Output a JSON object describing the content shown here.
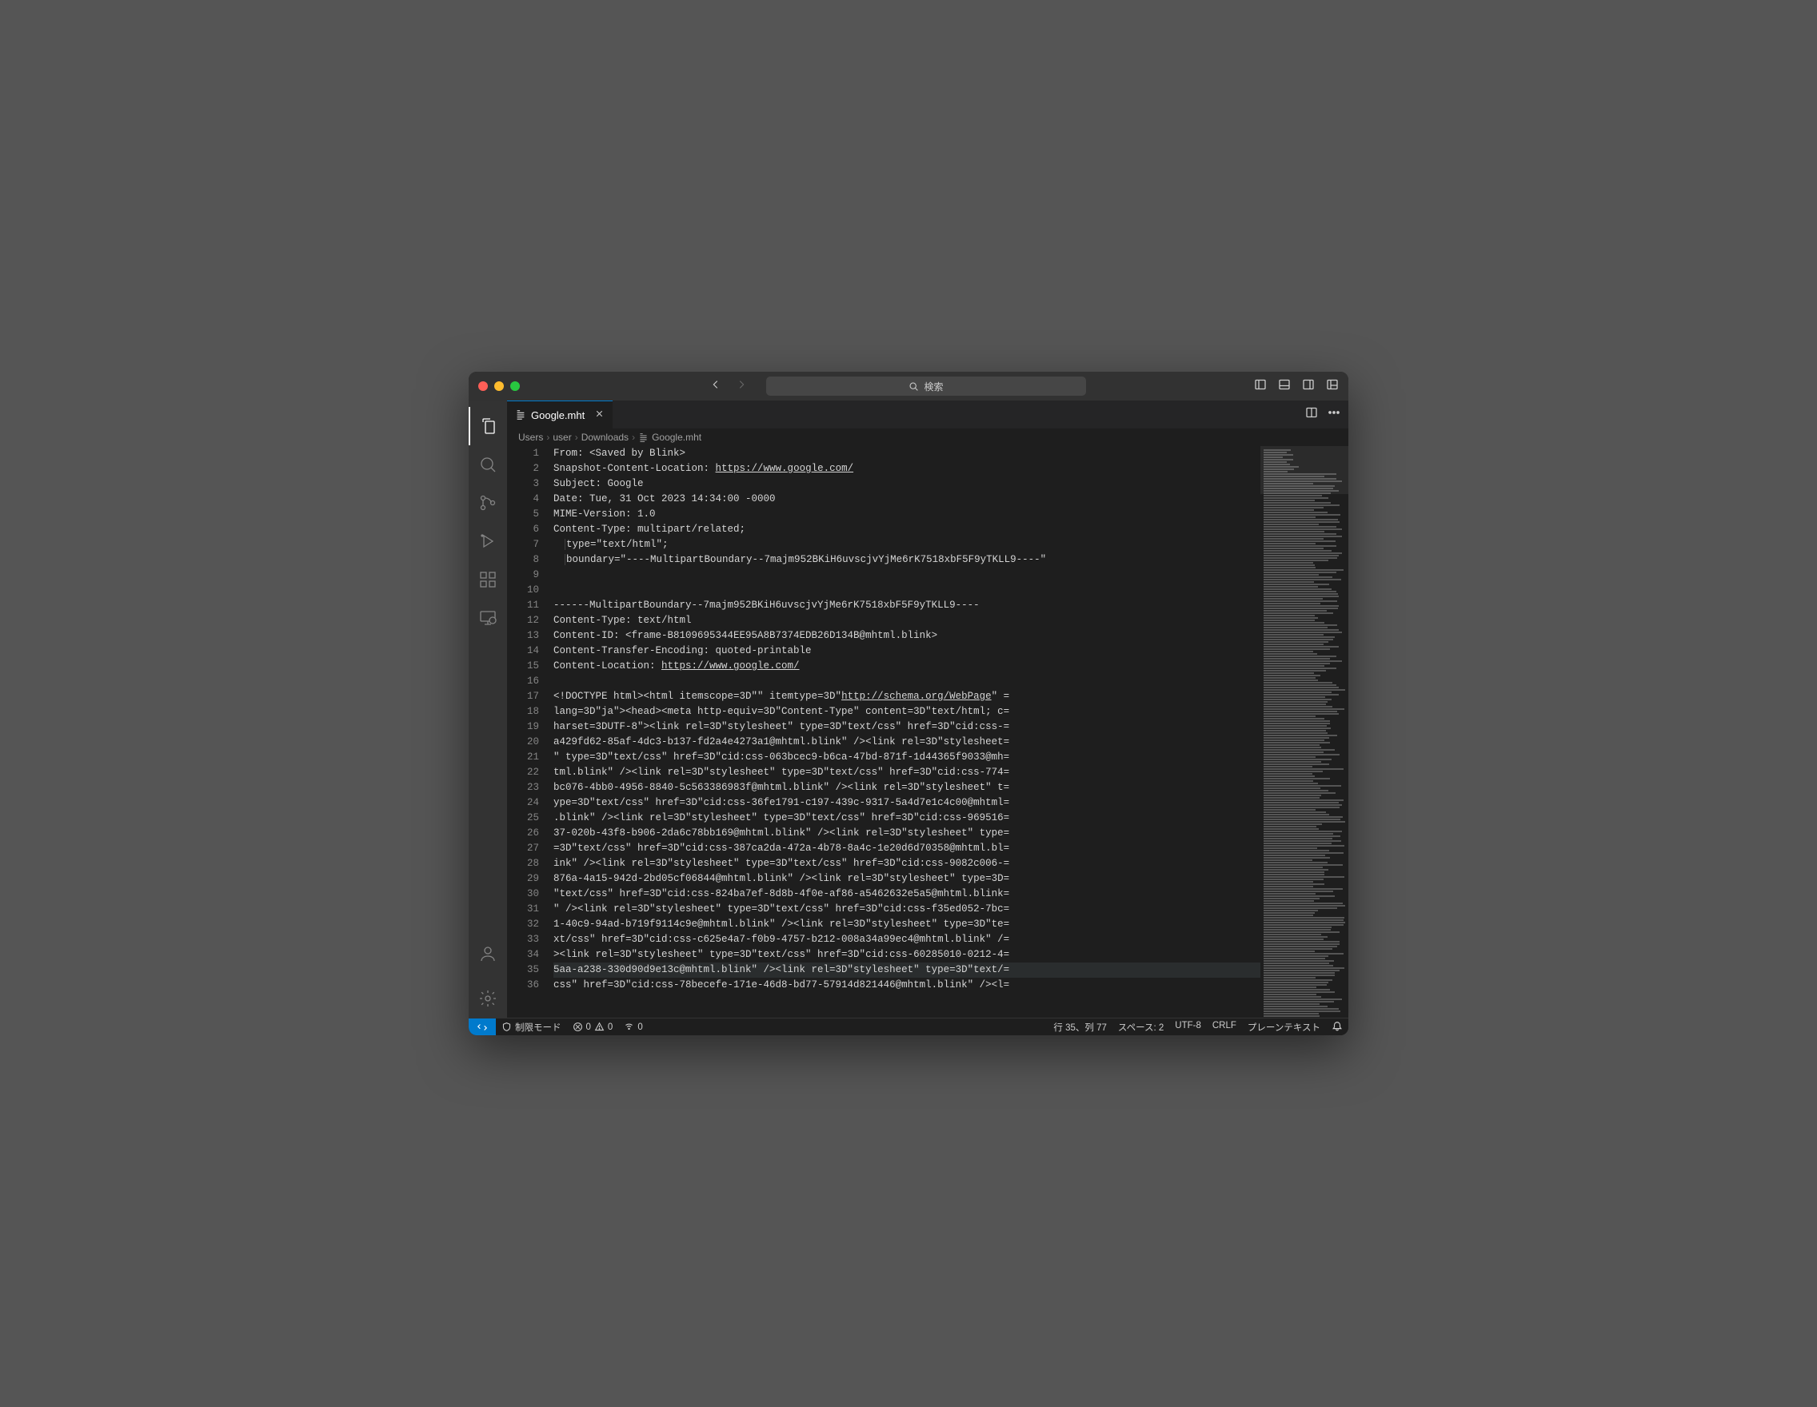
{
  "titlebar": {
    "search_placeholder": "検索"
  },
  "tab": {
    "filename": "Google.mht"
  },
  "breadcrumb": {
    "parts": [
      "Users",
      "user",
      "Downloads",
      "Google.mht"
    ]
  },
  "editor": {
    "lines": [
      {
        "n": 1,
        "text": "From: <Saved by Blink>"
      },
      {
        "n": 2,
        "prefix": "Snapshot-Content-Location: ",
        "link": "https://www.google.com/"
      },
      {
        "n": 3,
        "text": "Subject: Google"
      },
      {
        "n": 4,
        "text": "Date: Tue, 31 Oct 2023 14:34:00 -0000"
      },
      {
        "n": 5,
        "text": "MIME-Version: 1.0"
      },
      {
        "n": 6,
        "text": "Content-Type: multipart/related;"
      },
      {
        "n": 7,
        "indent": true,
        "text": "type=\"text/html\";"
      },
      {
        "n": 8,
        "indent": true,
        "text": "boundary=\"----MultipartBoundary--7majm952BKiH6uvscjvYjMe6rK7518xbF5F9yTKLL9----\""
      },
      {
        "n": 9,
        "text": ""
      },
      {
        "n": 10,
        "text": ""
      },
      {
        "n": 11,
        "text": "------MultipartBoundary--7majm952BKiH6uvscjvYjMe6rK7518xbF5F9yTKLL9----"
      },
      {
        "n": 12,
        "text": "Content-Type: text/html"
      },
      {
        "n": 13,
        "text": "Content-ID: <frame-B8109695344EE95A8B7374EDB26D134B@mhtml.blink>"
      },
      {
        "n": 14,
        "text": "Content-Transfer-Encoding: quoted-printable"
      },
      {
        "n": 15,
        "prefix": "Content-Location: ",
        "link": "https://www.google.com/"
      },
      {
        "n": 16,
        "text": ""
      },
      {
        "n": 17,
        "prefix": "<!DOCTYPE html><html itemscope=3D\"\" itemtype=3D\"",
        "link": "http://schema.org/WebPage",
        "suffix": "\" ="
      },
      {
        "n": 18,
        "text": "lang=3D\"ja\"><head><meta http-equiv=3D\"Content-Type\" content=3D\"text/html; c="
      },
      {
        "n": 19,
        "text": "harset=3DUTF-8\"><link rel=3D\"stylesheet\" type=3D\"text/css\" href=3D\"cid:css-="
      },
      {
        "n": 20,
        "text": "a429fd62-85af-4dc3-b137-fd2a4e4273a1@mhtml.blink\" /><link rel=3D\"stylesheet="
      },
      {
        "n": 21,
        "text": "\" type=3D\"text/css\" href=3D\"cid:css-063bcec9-b6ca-47bd-871f-1d44365f9033@mh="
      },
      {
        "n": 22,
        "text": "tml.blink\" /><link rel=3D\"stylesheet\" type=3D\"text/css\" href=3D\"cid:css-774="
      },
      {
        "n": 23,
        "text": "bc076-4bb0-4956-8840-5c563386983f@mhtml.blink\" /><link rel=3D\"stylesheet\" t="
      },
      {
        "n": 24,
        "text": "ype=3D\"text/css\" href=3D\"cid:css-36fe1791-c197-439c-9317-5a4d7e1c4c00@mhtml="
      },
      {
        "n": 25,
        "text": ".blink\" /><link rel=3D\"stylesheet\" type=3D\"text/css\" href=3D\"cid:css-969516="
      },
      {
        "n": 26,
        "text": "37-020b-43f8-b906-2da6c78bb169@mhtml.blink\" /><link rel=3D\"stylesheet\" type="
      },
      {
        "n": 27,
        "text": "=3D\"text/css\" href=3D\"cid:css-387ca2da-472a-4b78-8a4c-1e20d6d70358@mhtml.bl="
      },
      {
        "n": 28,
        "text": "ink\" /><link rel=3D\"stylesheet\" type=3D\"text/css\" href=3D\"cid:css-9082c006-="
      },
      {
        "n": 29,
        "text": "876a-4a15-942d-2bd05cf06844@mhtml.blink\" /><link rel=3D\"stylesheet\" type=3D="
      },
      {
        "n": 30,
        "text": "\"text/css\" href=3D\"cid:css-824ba7ef-8d8b-4f0e-af86-a5462632e5a5@mhtml.blink="
      },
      {
        "n": 31,
        "text": "\" /><link rel=3D\"stylesheet\" type=3D\"text/css\" href=3D\"cid:css-f35ed052-7bc="
      },
      {
        "n": 32,
        "text": "1-40c9-94ad-b719f9114c9e@mhtml.blink\" /><link rel=3D\"stylesheet\" type=3D\"te="
      },
      {
        "n": 33,
        "text": "xt/css\" href=3D\"cid:css-c625e4a7-f0b9-4757-b212-008a34a99ec4@mhtml.blink\" /="
      },
      {
        "n": 34,
        "text": "><link rel=3D\"stylesheet\" type=3D\"text/css\" href=3D\"cid:css-60285010-0212-4="
      },
      {
        "n": 35,
        "hl": true,
        "text": "5aa-a238-330d90d9e13c@mhtml.blink\" /><link rel=3D\"stylesheet\" type=3D\"text/="
      },
      {
        "n": 36,
        "text": "css\" href=3D\"cid:css-78becefe-171e-46d8-bd77-57914d821446@mhtml.blink\" /><l="
      }
    ]
  },
  "statusbar": {
    "restricted": "制限モード",
    "errors": "0",
    "warnings": "0",
    "ports": "0",
    "cursor": "行 35、列 77",
    "spaces": "スペース: 2",
    "encoding": "UTF-8",
    "eol": "CRLF",
    "language": "プレーンテキスト"
  }
}
